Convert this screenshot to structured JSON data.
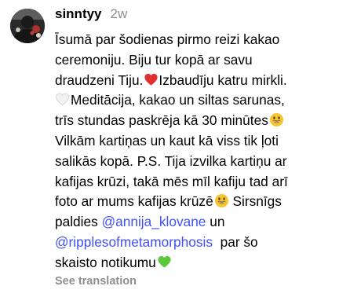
{
  "comment": {
    "username": "sinntyy",
    "timestamp": "2w",
    "lines": [
      "Īsumā par šodienas pirmo reizi kakao",
      "ceremoniju. Biju tur kopā ar savu",
      "draudzeni Tiju.",
      "Izbaudīju katru mirkli.",
      "Meditācija, kakao un siltas sarunas,",
      "trīs stundas paskrēja kā 30 minūtes",
      "Vilkām kartiņas un kaut kā viss tik ļoti",
      "salikās kopā. P.S. Tija izvilka kartiņu ar",
      "kafijas krūzi, takā mēs mīl kafiju tad arī",
      "foto ar mums kafijas krūzē",
      " Sirsnīgs",
      "paldies ",
      " un",
      "  par šo",
      "skaisto notikumu"
    ],
    "mentions": {
      "first": "@annija_klovane",
      "second": "@ripplesofmetamorphosis"
    },
    "emojis": {
      "heart_red": "red-heart-icon",
      "heart_white": "white-heart-icon",
      "smile": "grinning-face-icon",
      "heart_green": "green-heart-icon"
    },
    "see_translation": "See translation",
    "colors": {
      "username": "#000000",
      "timestamp": "#8e8e8e",
      "mention": "#4150f7",
      "see_translation": "#8e8e8e"
    }
  }
}
